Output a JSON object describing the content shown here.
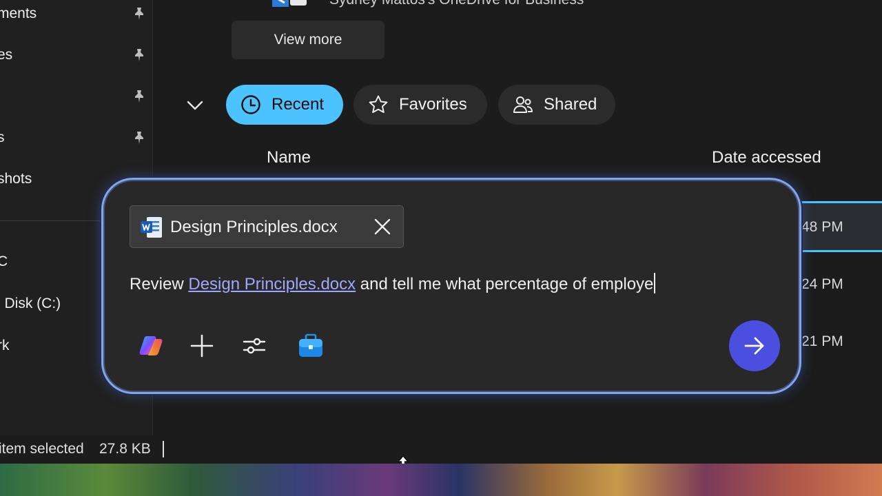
{
  "sidebar": {
    "items": [
      {
        "label": "ments",
        "pinned": true
      },
      {
        "label": "es",
        "pinned": true
      },
      {
        "label": "",
        "pinned": true
      },
      {
        "label": "s",
        "pinned": true
      },
      {
        "label": "shots",
        "pinned": false
      }
    ],
    "drives": [
      {
        "label": "C"
      },
      {
        "label": "l Disk (C:)"
      },
      {
        "label": "rk"
      }
    ]
  },
  "main": {
    "onedrive_label": "Sydney Mattos's OneDrive for Business",
    "view_more_label": "View more",
    "tabs": [
      {
        "label": "Recent",
        "icon": "clock-icon",
        "selected": true
      },
      {
        "label": "Favorites",
        "icon": "star-icon",
        "selected": false
      },
      {
        "label": "Shared",
        "icon": "people-icon",
        "selected": false
      }
    ],
    "columns": {
      "name": "Name",
      "date": "Date accessed"
    },
    "row_times": [
      "48 PM",
      "24 PM",
      "21 PM"
    ]
  },
  "copilot": {
    "attachment_name": "Design Principles.docx",
    "prompt_prefix": "Review ",
    "prompt_link": "Design Principles.docx",
    "prompt_suffix": " and tell me what percentage of employe",
    "tools": [
      "copilot-logo-icon",
      "add-icon",
      "settings-sliders-icon",
      "briefcase-icon"
    ],
    "send_icon": "arrow-right-icon"
  },
  "status_bar": {
    "selection": "item selected",
    "size": "27.8 KB"
  },
  "colors": {
    "accent": "#4cc2ff",
    "send_button": "#4b4fe0",
    "link": "#9fa8ff",
    "panel_glow": "#8aa6d8"
  }
}
